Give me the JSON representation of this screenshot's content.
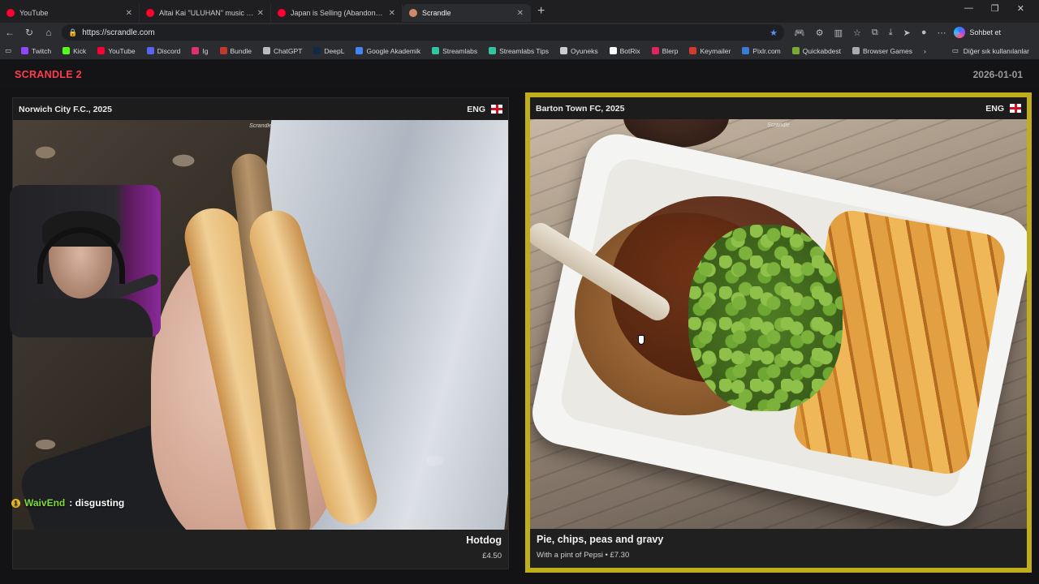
{
  "tabs": [
    {
      "label": "YouTube",
      "favicon_color": "#ff0033"
    },
    {
      "label": "Altai Kai \"ULUHAN\" music vid...",
      "favicon_color": "#ff0033"
    },
    {
      "label": "Japan is Selling (Abandoned) Hou...",
      "favicon_color": "#ff0033"
    },
    {
      "label": "Scrandle",
      "favicon_color": "#d08a6a"
    }
  ],
  "address": {
    "url": "https://scrandle.com"
  },
  "copilot": {
    "label": "Sohbet et"
  },
  "bookmarks": [
    {
      "label": "Twitch",
      "color": "#9146ff"
    },
    {
      "label": "Kick",
      "color": "#53fc18"
    },
    {
      "label": "YouTube",
      "color": "#ff0033"
    },
    {
      "label": "Discord",
      "color": "#5865f2"
    },
    {
      "label": "Ig",
      "color": "#e1306c"
    },
    {
      "label": "Bundle",
      "color": "#c0392b"
    },
    {
      "label": "ChatGPT",
      "color": "#bbbbbb"
    },
    {
      "label": "DeepL",
      "color": "#0f2b46"
    },
    {
      "label": "Google Akademik",
      "color": "#4285f4"
    },
    {
      "label": "Streamlabs",
      "color": "#31c3a2"
    },
    {
      "label": "Streamlabs Tips",
      "color": "#31c3a2"
    },
    {
      "label": "Oyuneks",
      "color": "#cccccc"
    },
    {
      "label": "BotRix",
      "color": "#ffffff"
    },
    {
      "label": "Blerp",
      "color": "#e0245e"
    },
    {
      "label": "Keymailer",
      "color": "#d33a2c"
    },
    {
      "label": "Pixlr.com",
      "color": "#3a7bd5"
    },
    {
      "label": "Quickabdest",
      "color": "#77aa33"
    },
    {
      "label": "Browser Games",
      "color": "#aaaaaa"
    }
  ],
  "bookmarks_other": "Diğer sık kullanılanlar",
  "game": {
    "brand": "SCRANDLE 2",
    "date": "2026-01-01",
    "watermark": "Scrandle",
    "left": {
      "club": "Norwich City F.C., 2025",
      "lang": "ENG",
      "food": "Hotdog",
      "detail": "£4.50"
    },
    "right": {
      "club": "Barton Town FC, 2025",
      "lang": "ENG",
      "food": "Pie, chips, peas and gravy",
      "detail": "With a pint of Pepsi • £7.30"
    }
  },
  "chat": {
    "user": "WaivEnd",
    "message": ": disgusting"
  },
  "colors": {
    "brand": "#ff3b4e",
    "selected_border": "#bfae1a",
    "chat_user": "#7fdc3a"
  }
}
